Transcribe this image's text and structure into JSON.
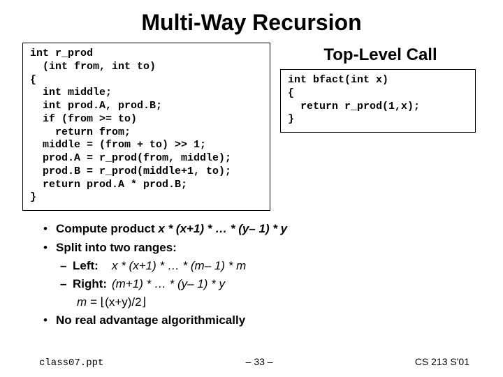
{
  "title": "Multi-Way Recursion",
  "subheading": "Top-Level Call",
  "code_left": "int r_prod\n  (int from, int to)\n{\n  int middle;\n  int prod.A, prod.B;\n  if (from >= to)\n    return from;\n  middle = (from + to) >> 1;\n  prod.A = r_prod(from, middle);\n  prod.B = r_prod(middle+1, to);\n  return prod.A * prod.B;\n}",
  "code_right": "int bfact(int x)\n{\n  return r_prod(1,x);\n}",
  "bullets": {
    "b1a_prefix": "Compute product ",
    "b1a_expr": "x * (x+1) * … * (y– 1) * y",
    "b1b": "Split into two ranges:",
    "left_label": "Left:",
    "left_expr": "x * (x+1) * … * (m– 1) * m",
    "right_label": "Right:",
    "right_expr": "(m+1) * … * (y– 1) * y",
    "m_line_pre": "m = ",
    "m_line_expr": "⌊(x+y)/2⌋",
    "b1c": "No real advantage algorithmically"
  },
  "footer": {
    "filename": "class07.ppt",
    "page": "– 33 –",
    "course": "CS 213 S'01"
  }
}
